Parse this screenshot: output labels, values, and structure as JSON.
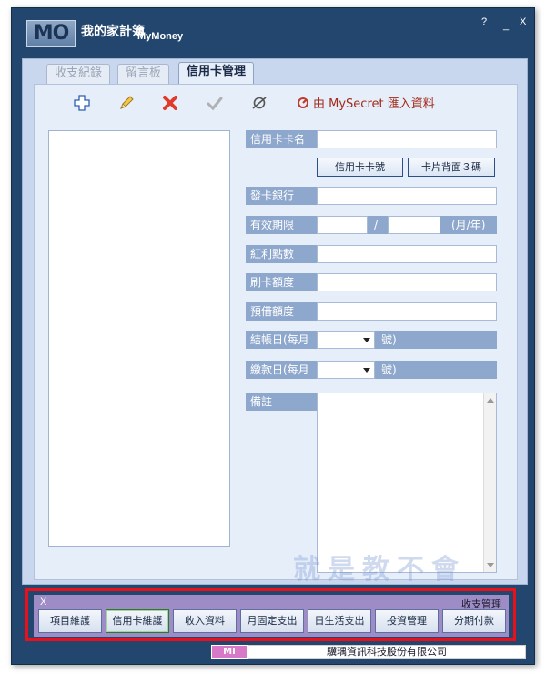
{
  "window": {
    "logo_text": "MO",
    "title": "我的家計簿",
    "subtitle": "MyMoney",
    "help": "?",
    "minimize": "_",
    "close": "X"
  },
  "tabs": [
    {
      "label": "收支紀錄",
      "active": false
    },
    {
      "label": "留言板",
      "active": false
    },
    {
      "label": "信用卡管理",
      "active": true
    }
  ],
  "toolbar": {
    "icons": [
      "add-icon",
      "edit-icon",
      "delete-icon",
      "confirm-icon",
      "cancel-icon"
    ],
    "import_label": "由 MySecret 匯入資料"
  },
  "form": {
    "card_name_label": "信用卡卡名",
    "card_number_btn": "信用卡卡號",
    "card_back_btn": "卡片背面３碼",
    "bank_label": "發卡銀行",
    "expiry_label": "有效期限",
    "expiry_sep": "/",
    "expiry_unit": "(月/年)",
    "points_label": "紅利點數",
    "credit_limit_label": "刷卡額度",
    "cash_limit_label": "預借額度",
    "billing_day_label": "結帳日(每月",
    "billing_day_suffix": "號)",
    "payment_day_label": "繳款日(每月",
    "payment_day_suffix": "號)",
    "memo_label": "備註"
  },
  "watermark": "就是教不會",
  "bottom_bar": {
    "close": "X",
    "title": "收支管理",
    "buttons": [
      {
        "label": "項目維護",
        "active": false
      },
      {
        "label": "信用卡維護",
        "active": true
      },
      {
        "label": "收入資料",
        "active": false
      },
      {
        "label": "月固定支出",
        "active": false
      },
      {
        "label": "日生活支出",
        "active": false
      },
      {
        "label": "投資管理",
        "active": false
      },
      {
        "label": "分期付款",
        "active": false
      }
    ]
  },
  "footer": {
    "logo_text": "MI",
    "company": "驥瑀資訊科技股份有限公司"
  },
  "colors": {
    "window_bg": "#23466e",
    "panel_bg": "#c8d7ee",
    "label_bg": "#8ea7cc",
    "bottom_bar_bg": "#9d8cc5",
    "highlight": "#e8101a",
    "import_text": "#a22a1a"
  }
}
